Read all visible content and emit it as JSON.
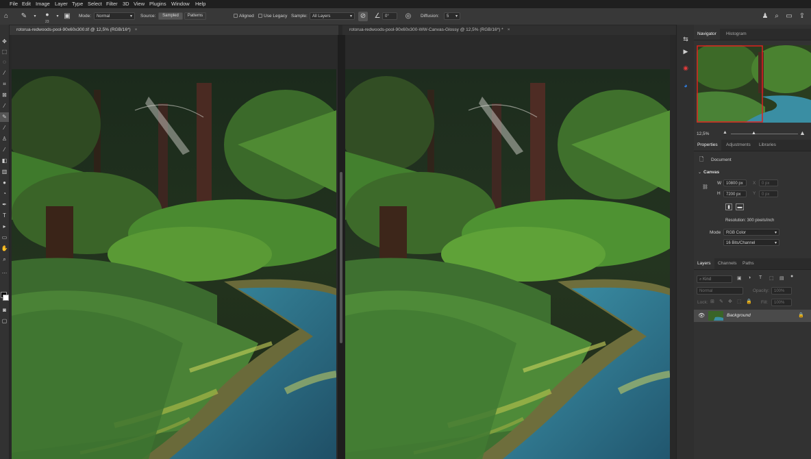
{
  "menu": [
    "File",
    "Edit",
    "Image",
    "Layer",
    "Type",
    "Select",
    "Filter",
    "3D",
    "View",
    "Plugins",
    "Window",
    "Help"
  ],
  "options": {
    "brush_size": "23",
    "mode_label": "Mode:",
    "mode_value": "Normal",
    "source_label": "Source:",
    "source_sampled": "Sampled",
    "source_patterns": "Patterns",
    "aligned_label": "Aligned",
    "use_legacy_label": "Use Legacy",
    "sample_label": "Sample:",
    "sample_value": "All Layers",
    "angle_value": "0°",
    "diffusion_label": "Diffusion:",
    "diffusion_value": "5"
  },
  "tabs": [
    {
      "title": "rotorua-redwoods-pool-90x60x300.tif @ 12,5% (RGB/16*)",
      "close": "×"
    },
    {
      "title": "rotorua-redwoods-pool-90x60x300-WW-Canvas-Glossy @ 12,5% (RGB/16*) *",
      "close": "×"
    }
  ],
  "navigator": {
    "tabs": [
      "Navigator",
      "Histogram"
    ],
    "zoom": "12,5%"
  },
  "properties": {
    "tabs": [
      "Properties",
      "Adjustments",
      "Libraries"
    ],
    "doc_label": "Document",
    "canvas_label": "Canvas",
    "w_label": "W",
    "w_value": "10800 px",
    "x_label": "X",
    "x_value": "0 px",
    "h_label": "H",
    "h_value": "7200 px",
    "y_label": "Y",
    "y_value": "0 px",
    "resolution": "Resolution: 300 pixels/inch",
    "mode_label": "Mode",
    "mode_value": "RGB Color",
    "bits_value": "16 Bits/Channel"
  },
  "layers": {
    "tabs": [
      "Layers",
      "Channels",
      "Paths"
    ],
    "kind_placeholder": "Kind",
    "blend_mode": "Normal",
    "opacity_label": "Opacity:",
    "opacity_value": "100%",
    "lock_label": "Lock:",
    "fill_label": "Fill:",
    "fill_value": "100%",
    "items": [
      {
        "name": "Background"
      }
    ]
  }
}
